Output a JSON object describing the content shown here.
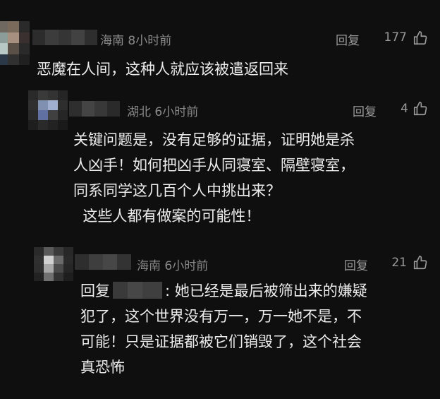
{
  "comments": [
    {
      "location": "海南",
      "time": "8小时前",
      "reply_label": "回复",
      "likes": "177",
      "text_lines": [
        "恶魔在人间，这种人就应该被遣返回来"
      ]
    },
    {
      "location": "湖北",
      "time": "6小时前",
      "reply_label": "回复",
      "likes": "4",
      "text_lines": [
        "关键问题是，没有足够的证据，证明她是杀",
        "人凶手！如何把凶手从同寝室、隔壁寝室，",
        "同系同学这几百个人中挑出来？",
        "  这些人都有做案的可能性！"
      ]
    },
    {
      "location": "海南",
      "time": "6小时前",
      "reply_label": "回复",
      "likes": "21",
      "reply_prefix": "回复",
      "text_first_rest": ": 她已经是最后被筛出来的嫌疑",
      "text_lines": [
        "犯了，这个世界没有万一，万一她不是，不",
        "可能！只是证据都被它们销毁了，这个社会",
        "真恐怖"
      ]
    }
  ],
  "icons": {
    "like": "thumbs-up-icon",
    "avatar": "avatar-blurred",
    "name": "username-blurred"
  }
}
